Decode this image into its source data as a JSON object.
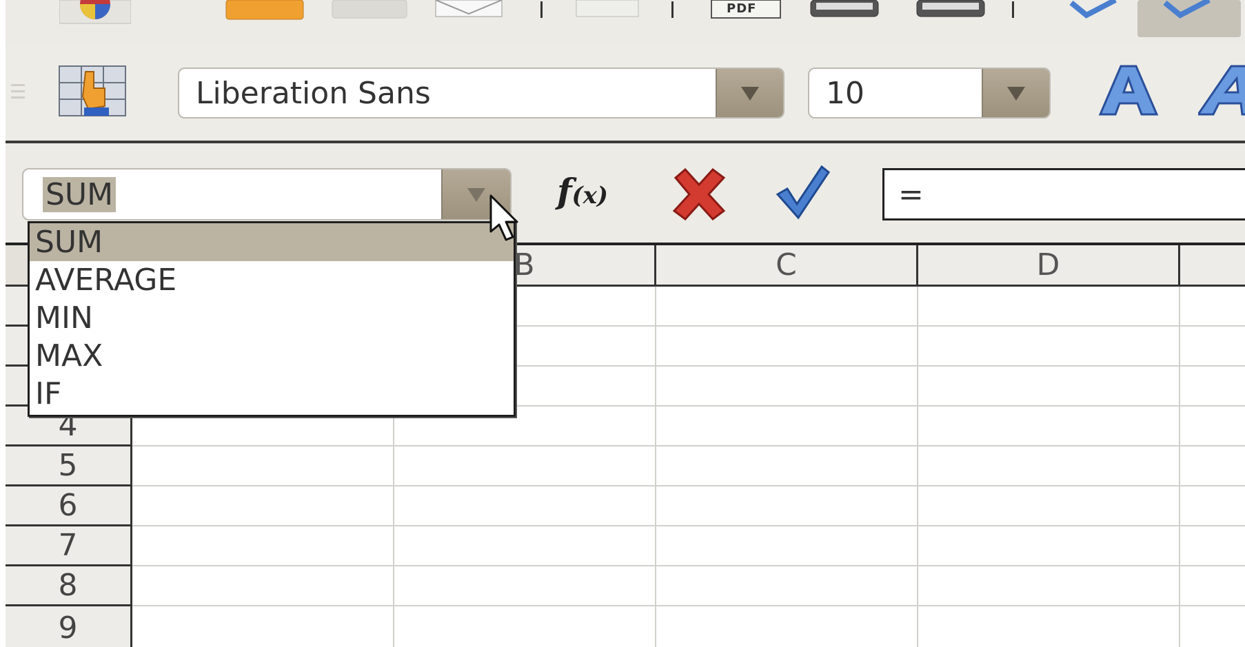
{
  "toolbar": {
    "pdf_label": "PDF"
  },
  "formatting": {
    "font_name": "Liberation Sans",
    "font_size": "10"
  },
  "formula_bar": {
    "name_box_value": "SUM",
    "fx_label": "f",
    "fx_sub": "(x)",
    "formula_value": "="
  },
  "function_list": {
    "items": [
      "SUM",
      "AVERAGE",
      "MIN",
      "MAX",
      "IF"
    ],
    "selected": "SUM"
  },
  "sheet": {
    "columns": [
      "B",
      "C",
      "D"
    ],
    "rows": [
      "4",
      "5",
      "6",
      "7",
      "8",
      "9"
    ]
  },
  "colors": {
    "accent_blue": "#4a7fd0",
    "cancel_red": "#c0302a",
    "selection": "#bcb4a3"
  }
}
